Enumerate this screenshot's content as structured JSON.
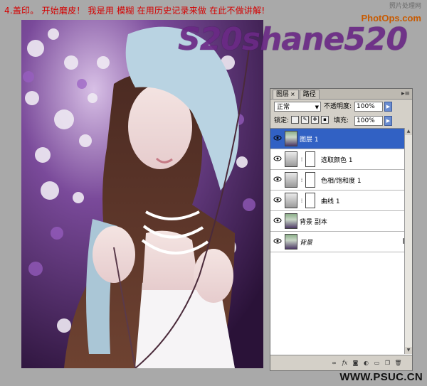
{
  "caption": "4.盖印。   开始磨皮！   我是用 模糊   在用历史记录来做  在此不做讲解!",
  "logo": {
    "cn": "照片处理网",
    "en": "PhotOps.com"
  },
  "watermark": "S20shane520",
  "panel": {
    "tabs": [
      {
        "label": "图层",
        "close": "×"
      },
      {
        "label": "路径"
      }
    ],
    "blend_mode": "正常",
    "opacity_label": "不透明度:",
    "opacity_value": "100%",
    "lock_label": "锁定:",
    "fill_label": "填充:",
    "fill_value": "100%",
    "layers": [
      {
        "name": "图层 1",
        "selected": true,
        "type": "photo"
      },
      {
        "name": "选取颜色 1",
        "type": "adjustment"
      },
      {
        "name": "色相/饱和度 1",
        "type": "adjustment"
      },
      {
        "name": "曲线 1",
        "type": "adjustment"
      },
      {
        "name": "背景 副本",
        "type": "photo"
      },
      {
        "name": "背景",
        "type": "photo",
        "italic": true,
        "locked": true
      }
    ],
    "bottom_icons": [
      "link-icon",
      "fx-icon",
      "mask-icon",
      "adjustment-icon",
      "folder-icon",
      "new-layer-icon",
      "trash-icon"
    ]
  },
  "footer_url": "WWW.PSUC.CN"
}
